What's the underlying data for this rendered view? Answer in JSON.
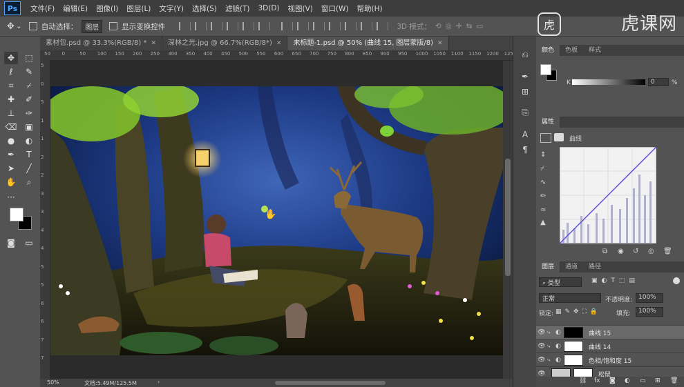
{
  "app": {
    "logo": "Ps"
  },
  "menu": [
    "文件(F)",
    "编辑(E)",
    "图像(I)",
    "图层(L)",
    "文字(Y)",
    "选择(S)",
    "滤镜(T)",
    "3D(D)",
    "视图(V)",
    "窗口(W)",
    "帮助(H)"
  ],
  "watermark": {
    "logo_char": "虎",
    "text": "虎课网"
  },
  "options_bar": {
    "auto_select_label": "自动选择：",
    "auto_select_value": "图层",
    "show_transform_label": "显示变换控件",
    "mode_3d_label": "3D 模式："
  },
  "tabs": [
    {
      "label": "素材包.psd @ 33.3%(RGB/8) *",
      "active": false
    },
    {
      "label": "深林之光.jpg @ 66.7%(RGB/8*)",
      "active": false
    },
    {
      "label": "未标题-1.psd @ 50% (曲线 15, 图层蒙版/8)",
      "active": true
    }
  ],
  "ruler_top": [
    "50",
    "0",
    "50",
    "100",
    "150",
    "200",
    "250",
    "300",
    "350",
    "400",
    "450",
    "500",
    "550",
    "600",
    "650",
    "700",
    "750",
    "800",
    "850",
    "900",
    "950",
    "1000",
    "1050",
    "1100",
    "1150",
    "1200",
    "1250"
  ],
  "ruler_left": [
    "5",
    "0",
    "5",
    "1",
    "1",
    "2",
    "2",
    "3",
    "3",
    "4",
    "4",
    "5",
    "5",
    "6",
    "6",
    "7",
    "7"
  ],
  "status": {
    "zoom": "50%",
    "doc": "文档:5.49M/125.5M"
  },
  "color_panel": {
    "tabs": [
      "颜色",
      "色板",
      "样式"
    ],
    "slider_label": "K",
    "slider_value": "0",
    "slider_unit": "%"
  },
  "properties_panel": {
    "tab": "属性",
    "adjust_name": "曲线"
  },
  "layers_panel": {
    "tabs": [
      "图层",
      "通道",
      "路径"
    ],
    "filter_kind": "类型",
    "blend_mode": "正常",
    "opacity_label": "不透明度:",
    "opacity_value": "100%",
    "lock_label": "锁定:",
    "fill_label": "填充:",
    "fill_value": "100%",
    "layers": [
      {
        "name": "曲线 15",
        "selected": true,
        "mask": "black"
      },
      {
        "name": "曲线 14",
        "selected": false,
        "mask": "white"
      },
      {
        "name": "色相/饱和度 15",
        "selected": false,
        "mask": "white"
      },
      {
        "name": "松鼠",
        "selected": false,
        "mask": "white"
      }
    ]
  },
  "colors": {
    "accent": "#4aa3ff",
    "fg_swatch": "#ffffff",
    "bg_swatch": "#000000"
  }
}
